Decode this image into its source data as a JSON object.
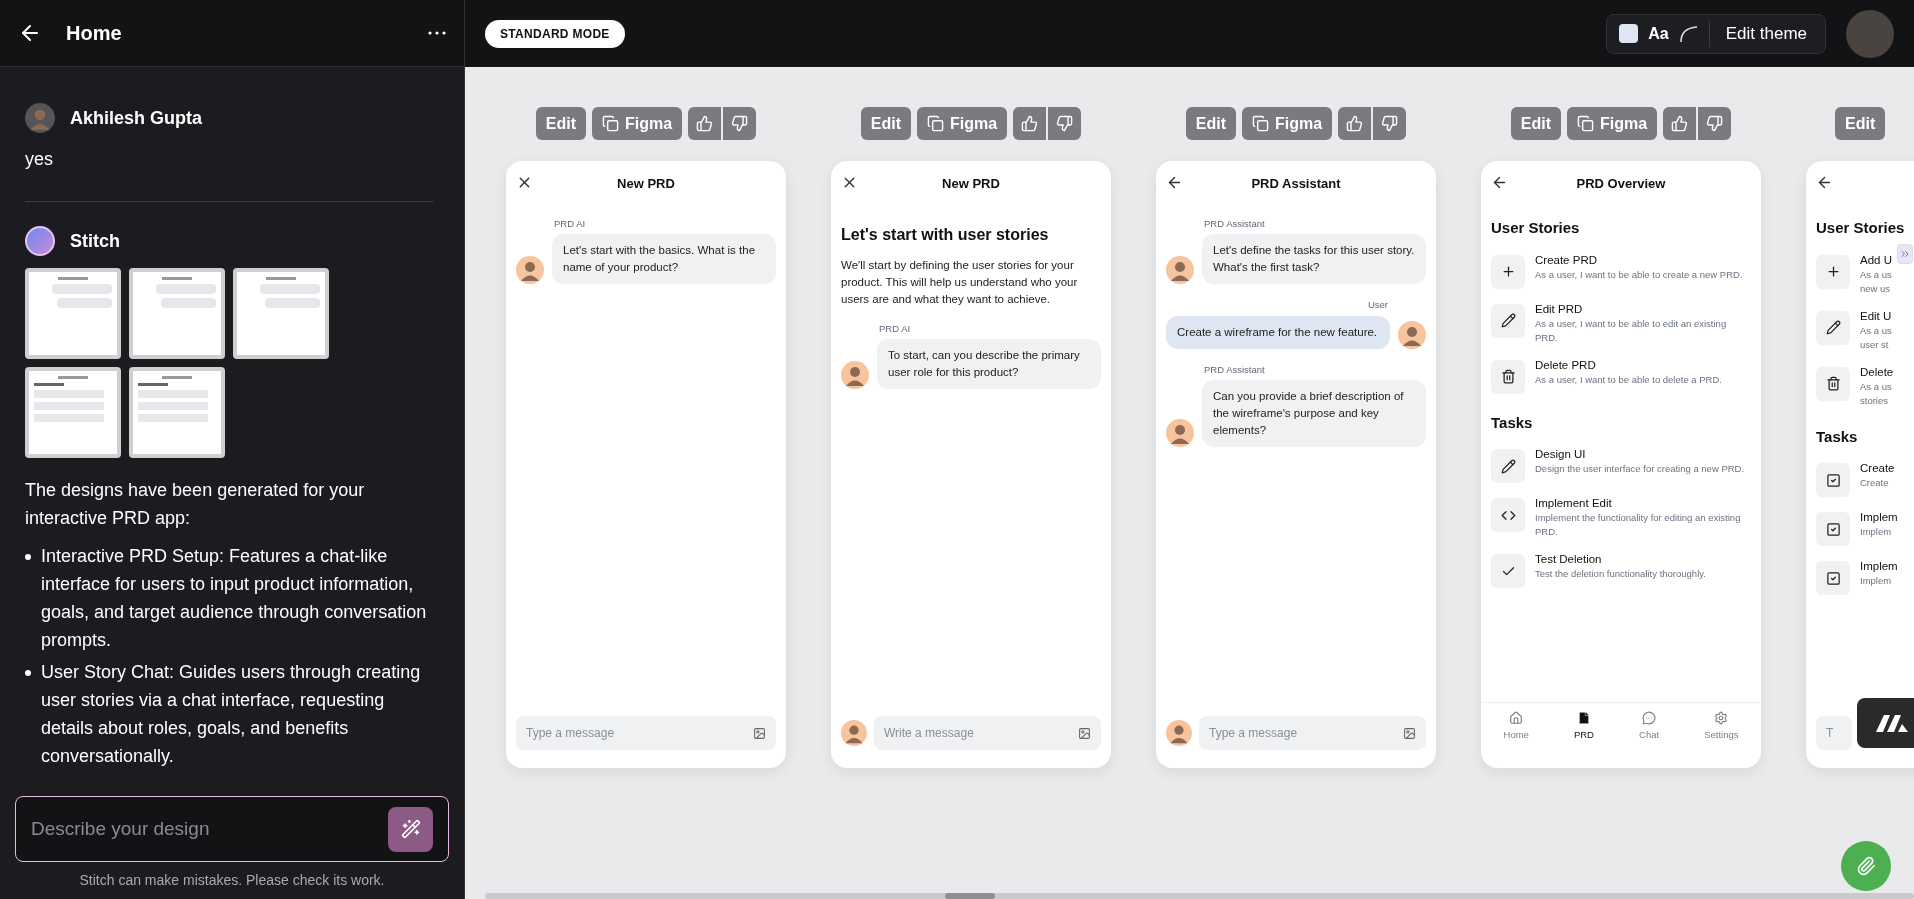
{
  "sidebar": {
    "title": "Home",
    "messages": [
      {
        "kind": "user",
        "author": "Akhilesh Gupta",
        "text": "yes"
      },
      {
        "kind": "assistant",
        "author": "Stitch",
        "thumbnails": [
          {
            "kind": "chat"
          },
          {
            "kind": "chat"
          },
          {
            "kind": "chat"
          },
          {
            "kind": "list"
          },
          {
            "kind": "list"
          }
        ],
        "text": "The designs have been generated for your interactive PRD app:",
        "bullets": [
          "Interactive PRD Setup: Features a chat-like interface for users to input product information, goals, and target audience through conversation prompts.",
          "User Story Chat: Guides users through creating user stories via a chat interface, requesting details about roles, goals, and benefits conversationally."
        ]
      }
    ],
    "composer": {
      "placeholder": "Describe your design"
    },
    "disclaimer": "Stitch can make mistakes. Please check its work."
  },
  "topbar": {
    "mode_badge": "STANDARD MODE",
    "theme_font": "Aa",
    "theme_button": "Edit theme"
  },
  "screens": [
    {
      "kind": "chat",
      "toolbar": {
        "edit": "Edit",
        "figma": "Figma"
      },
      "header": {
        "kind": "close",
        "title": "New PRD"
      },
      "messages": [
        {
          "kind": "ai",
          "sender": "PRD AI",
          "text": "Let's start with the basics. What is the name of your product?"
        }
      ],
      "composer": {
        "kind": "plain",
        "placeholder": "Type a message"
      }
    },
    {
      "kind": "chat",
      "toolbar": {
        "edit": "Edit",
        "figma": "Figma"
      },
      "header": {
        "kind": "close",
        "title": "New PRD"
      },
      "heading": "Let's start with user stories",
      "intro": "We'll start by defining the user stories for your product. This will help us understand who your users are and what they want to achieve.",
      "messages": [
        {
          "kind": "ai",
          "sender": "PRD AI",
          "text": "To start, can you describe the primary user role for this product?"
        }
      ],
      "composer": {
        "kind": "avatar",
        "placeholder": "Write a message"
      }
    },
    {
      "kind": "chat",
      "toolbar": {
        "edit": "Edit",
        "figma": "Figma"
      },
      "header": {
        "kind": "back",
        "title": "PRD Assistant"
      },
      "messages": [
        {
          "kind": "ai",
          "sender": "PRD Assistant",
          "text": "Let's define the tasks for this user story. What's the first task?"
        },
        {
          "kind": "user",
          "sender": "User",
          "text": "Create a wireframe for the new feature."
        },
        {
          "kind": "ai",
          "sender": "PRD Assistant",
          "text": "Can you provide a brief description of the wireframe's purpose and key elements?"
        }
      ],
      "composer": {
        "kind": "avatar",
        "placeholder": "Type a message"
      }
    },
    {
      "kind": "overview",
      "toolbar": {
        "edit": "Edit",
        "figma": "Figma"
      },
      "header": {
        "kind": "back",
        "title": "PRD Overview"
      },
      "sections": [
        {
          "heading": "User Stories",
          "items": [
            {
              "kind": "plus",
              "title": "Create PRD",
              "desc": "As a user, I want to be able to create a new PRD."
            },
            {
              "kind": "pencil",
              "title": "Edit PRD",
              "desc": "As a user, I want to be able to edit an existing PRD."
            },
            {
              "kind": "trash",
              "title": "Delete PRD",
              "desc": "As a user, I want to be able to delete a PRD."
            }
          ]
        },
        {
          "heading": "Tasks",
          "items": [
            {
              "kind": "pencil",
              "title": "Design UI",
              "desc": "Design the user interface for creating a new PRD."
            },
            {
              "kind": "code",
              "title": "Implement Edit",
              "desc": "Implement the functionality for editing an existing PRD."
            },
            {
              "kind": "check",
              "title": "Test Deletion",
              "desc": "Test the deletion functionality thoroughly."
            }
          ]
        }
      ],
      "nav": [
        {
          "kind": "home",
          "label": "Home",
          "selected": false
        },
        {
          "kind": "file",
          "label": "PRD",
          "selected": true
        },
        {
          "kind": "chat",
          "label": "Chat",
          "selected": false
        },
        {
          "kind": "settings",
          "label": "Settings",
          "selected": false
        }
      ]
    },
    {
      "kind": "overview",
      "toolbar": {
        "edit": "Edit"
      },
      "header": {
        "kind": "back"
      },
      "sections": [
        {
          "heading": "User Stories",
          "items": [
            {
              "kind": "plus",
              "title": "Add U",
              "desc": "As a us\nnew us"
            },
            {
              "kind": "pencil",
              "title": "Edit U",
              "desc": "As a us\nuser st"
            },
            {
              "kind": "trash",
              "title": "Delete",
              "desc": "As a us\nstories"
            }
          ]
        },
        {
          "heading": "Tasks",
          "items": [
            {
              "kind": "checkbox",
              "title": "Create",
              "desc": "Create"
            },
            {
              "kind": "checkbox",
              "title": "Implem",
              "desc": "Implem"
            },
            {
              "kind": "checkbox",
              "title": "Implem",
              "desc": "Implem"
            }
          ]
        }
      ],
      "composer": {
        "kind": "covered",
        "placeholder": "T"
      }
    }
  ]
}
